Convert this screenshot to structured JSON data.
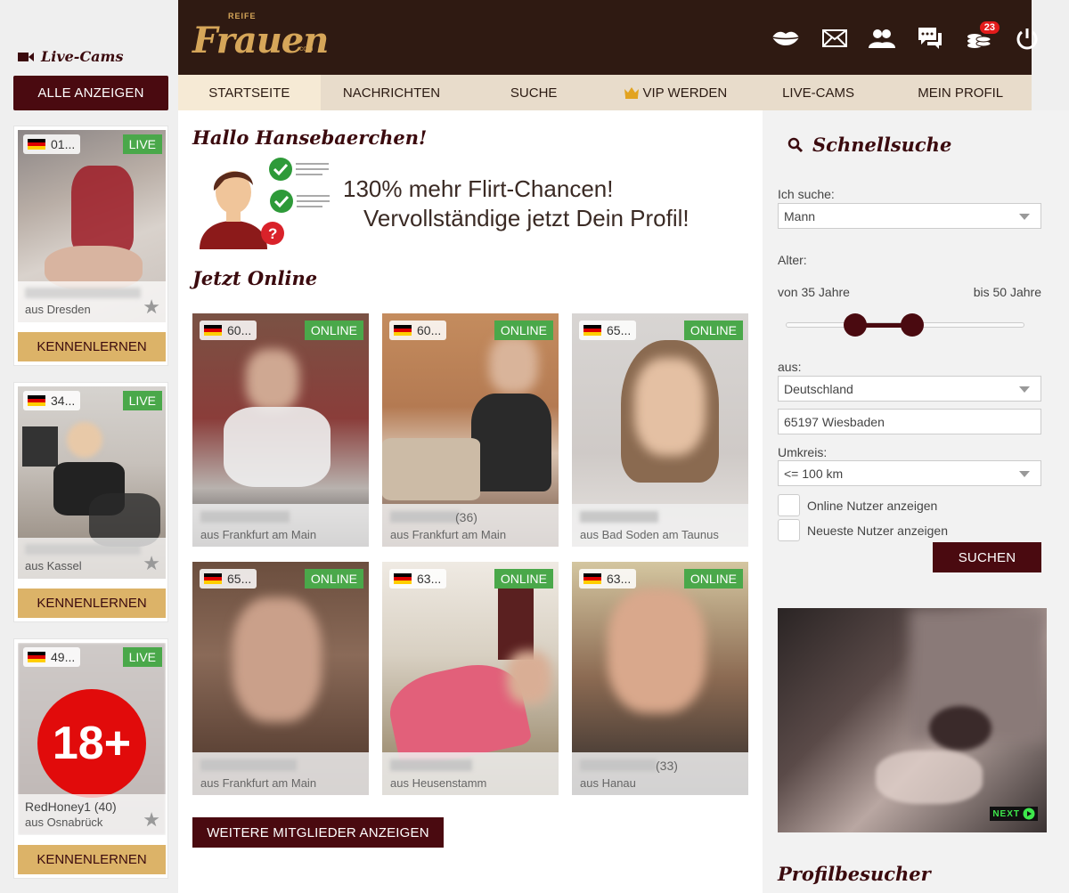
{
  "sidebar": {
    "title": "Live-Cams",
    "all_button": "ALLE ANZEIGEN",
    "cams": [
      {
        "age": "01...",
        "live": "LIVE",
        "name": "",
        "city": "aus Dresden",
        "cta": "KENNENLERNEN"
      },
      {
        "age": "34...",
        "live": "LIVE",
        "name": "",
        "city": "aus Kassel",
        "cta": "KENNENLERNEN"
      },
      {
        "age": "49...",
        "live": "LIVE",
        "name": "RedHoney1 (40)",
        "city": "aus Osnabrück",
        "cta": "KENNENLERNEN",
        "overlay": "18+"
      }
    ]
  },
  "header": {
    "logo_small": "REIFE",
    "logo_word": "Frauen",
    "logo_com": ".com",
    "coin_count": "23",
    "icons": [
      "lips-icon",
      "mail-icon",
      "users-icon",
      "chat-icon",
      "coins-icon",
      "power-icon"
    ]
  },
  "nav": {
    "items": [
      "STARTSEITE",
      "NACHRICHTEN",
      "SUCHE",
      "VIP WERDEN",
      "LIVE-CAMS",
      "MEIN PROFIL"
    ],
    "active": "STARTSEITE"
  },
  "main": {
    "greeting": "Hallo Hansebaerchen!",
    "banner_line1": "130% mehr Flirt-Chancen!",
    "banner_line2": "Vervollständige jetzt Dein Profil!",
    "online_title": "Jetzt Online",
    "members": [
      {
        "age": "60...",
        "status": "ONLINE",
        "age_num": "",
        "city": "aus Frankfurt am Main"
      },
      {
        "age": "60...",
        "status": "ONLINE",
        "age_num": "(36)",
        "city": "aus Frankfurt am Main"
      },
      {
        "age": "65...",
        "status": "ONLINE",
        "age_num": "",
        "city": "aus Bad Soden am Taunus"
      },
      {
        "age": "65...",
        "status": "ONLINE",
        "age_num": "",
        "city": "aus Frankfurt am Main"
      },
      {
        "age": "63...",
        "status": "ONLINE",
        "age_num": "",
        "city": "aus Heusenstamm"
      },
      {
        "age": "63...",
        "status": "ONLINE",
        "age_num": "(33)",
        "city": "aus Hanau"
      }
    ],
    "more_button": "WEITERE MITGLIEDER ANZEIGEN"
  },
  "search": {
    "title": "Schnellsuche",
    "looking_label": "Ich suche:",
    "looking_value": "Mann",
    "age_label": "Alter:",
    "age_from": "von 35 Jahre",
    "age_to": "bis 50 Jahre",
    "age_min": 35,
    "age_max": 50,
    "from_label": "aus:",
    "country": "Deutschland",
    "location": "65197 Wiesbaden",
    "radius_label": "Umkreis:",
    "radius": "<= 100 km",
    "check_online": "Online Nutzer anzeigen",
    "check_newest": "Neueste Nutzer anzeigen",
    "submit": "SUCHEN"
  },
  "ad": {
    "tag": "NEXT"
  },
  "visitors_title": "Profilbesucher",
  "colors": {
    "brand_dark": "#4a0a10",
    "header_bg": "#2f1a12",
    "gold": "#dcb368",
    "online_green": "#4aa84a",
    "nav_bg": "#e8dccb"
  }
}
